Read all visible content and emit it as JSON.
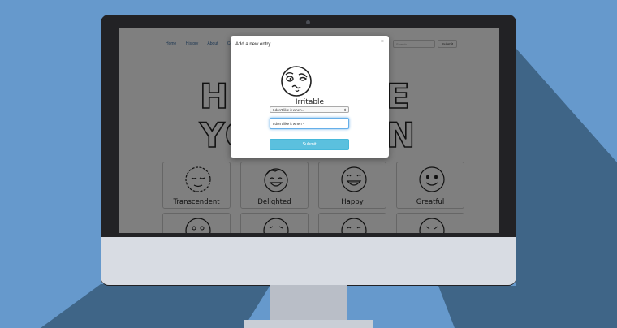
{
  "nav": {
    "home": "Home",
    "history": "History",
    "about": "About",
    "contact": "Co"
  },
  "search": {
    "placeholder": "Search",
    "submit_label": "Submit"
  },
  "hero": {
    "line1": "H",
    "line1_right": "E",
    "line2_left": "YO",
    "line2_right": "N"
  },
  "tiles": [
    {
      "label": "Transcendent"
    },
    {
      "label": "Delighted"
    },
    {
      "label": "Happy"
    },
    {
      "label": "Greatful"
    }
  ],
  "modal": {
    "title": "Add a new entry",
    "close": "×",
    "mood": "Irritable",
    "select_value": "I don't like it when...",
    "text_value": "I don't like it when -",
    "submit_label": "Submit"
  }
}
